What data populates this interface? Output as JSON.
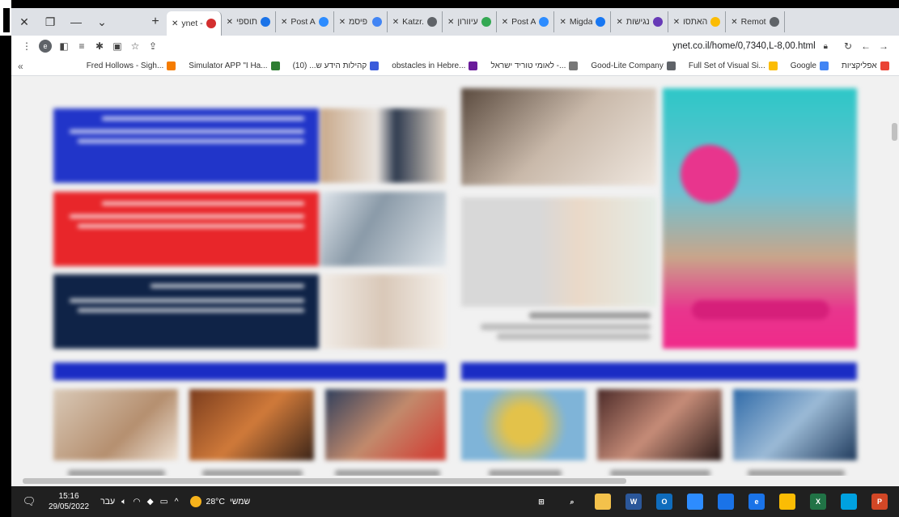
{
  "browser": {
    "window_controls": {
      "close": "✕",
      "restore": "❐",
      "minimize": "—",
      "menu": "⌄"
    },
    "new_tab": "+",
    "tabs": [
      {
        "title": "ynet -",
        "favicon_color": "#d32f2f",
        "active": true
      },
      {
        "title": "תוספי",
        "favicon_color": "#1a73e8"
      },
      {
        "title": "Post A",
        "favicon_color": "#2d8cff"
      },
      {
        "title": "פיסמ",
        "favicon_color": "#4285f4"
      },
      {
        "title": "Katzr.",
        "favicon_color": "#5f6368"
      },
      {
        "title": "עיוורון",
        "favicon_color": "#34a853"
      },
      {
        "title": "Post A",
        "favicon_color": "#2d8cff"
      },
      {
        "title": "Migda",
        "favicon_color": "#1877f2"
      },
      {
        "title": "נגישות",
        "favicon_color": "#673ab7"
      },
      {
        "title": "האתסו",
        "favicon_color": "#fbbc04"
      },
      {
        "title": "Remot",
        "favicon_color": "#5f6368"
      }
    ],
    "url": "ynet.co.il/home/0,7340,L-8,00.html",
    "profile_initial": "e",
    "bookmarks": [
      {
        "label": "אפליקציות",
        "color": "#ea4335"
      },
      {
        "label": "Google",
        "color": "#4285f4"
      },
      {
        "label": "Full Set of Visual Si...",
        "color": "#fbbc04"
      },
      {
        "label": "Good-Lite Company",
        "color": "#5f6368"
      },
      {
        "label": "לאומי טוריד ישראל -...",
        "color": "#777777"
      },
      {
        "label": "obstacles in Hebre...",
        "color": "#6a1b9a"
      },
      {
        "label": "קהילות הידע ש... (10)",
        "color": "#3b5bdb"
      },
      {
        "label": "Simulator APP \"I Ha...",
        "color": "#2e7d32"
      },
      {
        "label": "Fred Hollows - Sigh...",
        "color": "#f57c00"
      }
    ],
    "bookmarks_more": "«"
  },
  "taskbar": {
    "time": "15:16",
    "date": "29/05/2022",
    "language": "עבר",
    "weather_temp": "28°C",
    "weather_label": "שמשי",
    "apps": [
      {
        "name": "windows-start-icon",
        "label": "⊞",
        "color": "#202020"
      },
      {
        "name": "search-icon",
        "label": "⌕",
        "color": "#202020"
      },
      {
        "name": "file-explorer-icon",
        "label": "",
        "color": "#f3c14b"
      },
      {
        "name": "word-icon",
        "label": "W",
        "color": "#2b579a"
      },
      {
        "name": "outlook-icon",
        "label": "O",
        "color": "#0f6cbd"
      },
      {
        "name": "zoom-icon",
        "label": "",
        "color": "#2d8cff"
      },
      {
        "name": "teams-icon",
        "label": "",
        "color": "#1a73e8"
      },
      {
        "name": "edge-icon",
        "label": "e",
        "color": "#1a73e8"
      },
      {
        "name": "chrome-icon",
        "label": "",
        "color": "#fbbc04"
      },
      {
        "name": "excel-icon",
        "label": "X",
        "color": "#217346"
      },
      {
        "name": "salesforce-icon",
        "label": "",
        "color": "#00a1e0"
      },
      {
        "name": "powerpoint-icon",
        "label": "P",
        "color": "#d24726"
      }
    ]
  }
}
